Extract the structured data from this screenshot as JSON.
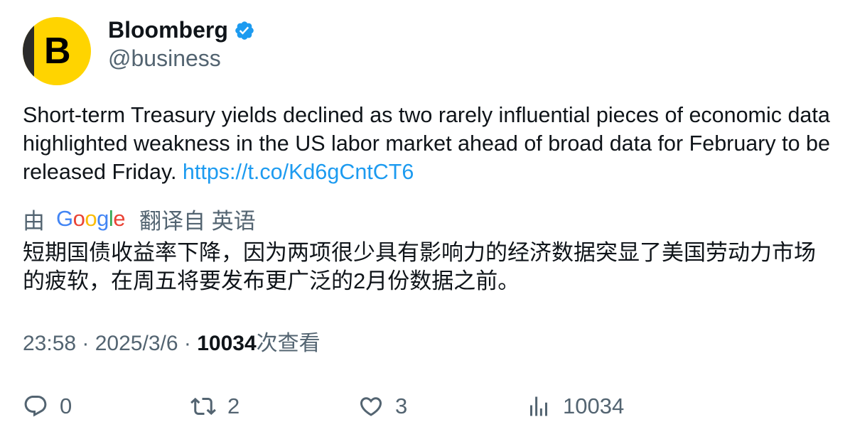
{
  "author": {
    "name": "Bloomberg",
    "handle": "@business",
    "avatar_letter": "B",
    "verified": true,
    "avatar_color": "#ffd400"
  },
  "tweet": {
    "text": "Short-term Treasury yields declined as two rarely influential pieces of economic data highlighted weakness in the US labor market ahead of broad data for February to be released Friday.",
    "link": "https://t.co/Kd6gCntCT6"
  },
  "translation": {
    "by_label": "由",
    "provider": "Google",
    "translated_label": "翻译自 英语",
    "text": "短期国债收益率下降，因为两项很少具有影响力的经济数据突显了美国劳动力市场的疲软，在周五将要发布更广泛的2月份数据之前。"
  },
  "meta": {
    "time": "23:58",
    "separator": " · ",
    "date": "2025/3/6",
    "views_count": "10034",
    "views_label": "次查看"
  },
  "actions": {
    "replies": "0",
    "retweets": "2",
    "likes": "3",
    "views": "10034"
  },
  "colors": {
    "link": "#1d9bf0",
    "secondary_text": "#536471",
    "primary_text": "#0f1419",
    "verified": "#1d9bf0"
  },
  "icons": [
    "verified-badge-icon",
    "reply-icon",
    "retweet-icon",
    "like-icon",
    "views-icon"
  ]
}
